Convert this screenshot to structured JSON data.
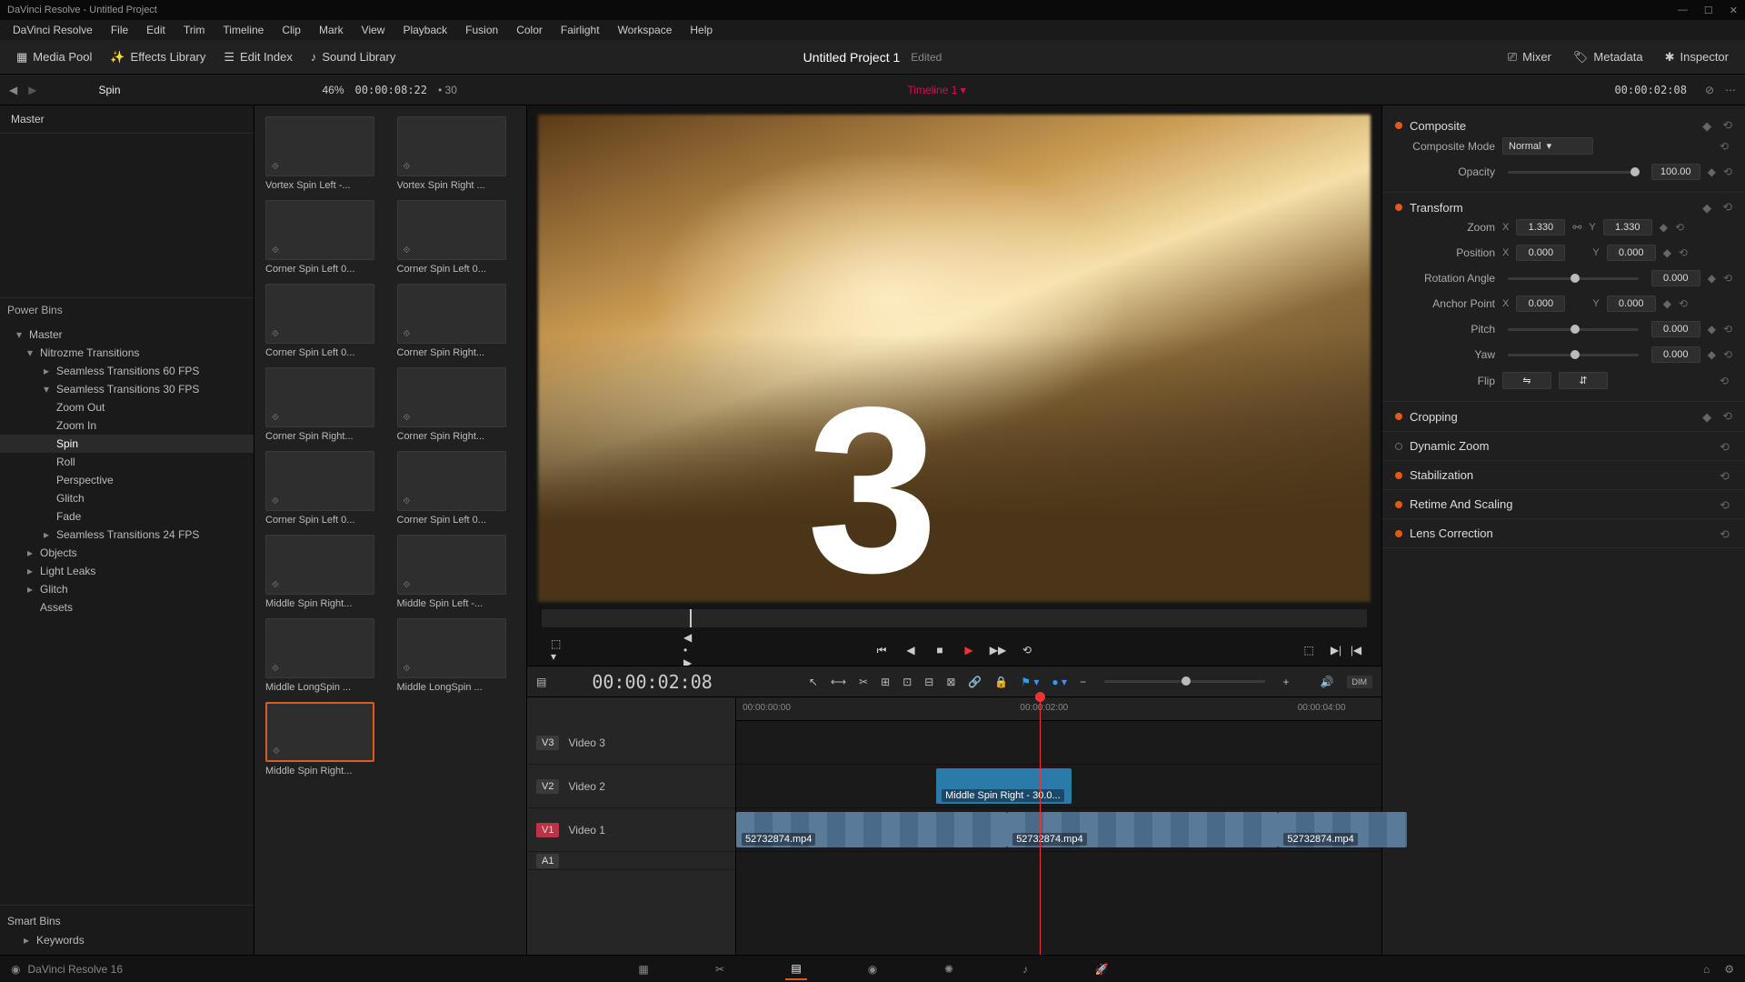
{
  "app": {
    "title": "DaVinci Resolve - Untitled Project",
    "name": "DaVinci Resolve 16"
  },
  "menu": [
    "DaVinci Resolve",
    "File",
    "Edit",
    "Trim",
    "Timeline",
    "Clip",
    "Mark",
    "View",
    "Playback",
    "Fusion",
    "Color",
    "Fairlight",
    "Workspace",
    "Help"
  ],
  "toolbar": {
    "media_pool": "Media Pool",
    "effects_library": "Effects Library",
    "edit_index": "Edit Index",
    "sound_library": "Sound Library",
    "project_title": "Untitled Project 1",
    "project_status": "Edited",
    "mixer": "Mixer",
    "metadata": "Metadata",
    "inspector": "Inspector"
  },
  "secbar": {
    "current_folder": "Spin",
    "zoom_pct": "46%",
    "timecode": "00:00:08:22",
    "fps": "• 30",
    "timeline_name": "Timeline 1",
    "timecode_right": "00:00:02:08"
  },
  "left_panel": {
    "master": "Master",
    "power_bins": "Power Bins",
    "smart_bins": "Smart Bins",
    "tree": [
      {
        "label": "Master",
        "level": 1,
        "arrow": "▾"
      },
      {
        "label": "Nitrozme Transitions",
        "level": 2,
        "arrow": "▾"
      },
      {
        "label": "Seamless Transitions 60 FPS",
        "level": 3,
        "arrow": "▸"
      },
      {
        "label": "Seamless Transitions 30 FPS",
        "level": 3,
        "arrow": "▾"
      },
      {
        "label": "Zoom Out",
        "level": 3
      },
      {
        "label": "Zoom In",
        "level": 3
      },
      {
        "label": "Spin",
        "level": 3,
        "active": true
      },
      {
        "label": "Roll",
        "level": 3
      },
      {
        "label": "Perspective",
        "level": 3
      },
      {
        "label": "Glitch",
        "level": 3
      },
      {
        "label": "Fade",
        "level": 3
      },
      {
        "label": "Seamless Transitions 24 FPS",
        "level": 3,
        "arrow": "▸"
      },
      {
        "label": "Objects",
        "level": 2,
        "arrow": "▸"
      },
      {
        "label": "Light Leaks",
        "level": 2,
        "arrow": "▸"
      },
      {
        "label": "Glitch",
        "level": 2,
        "arrow": "▸"
      },
      {
        "label": "Assets",
        "level": 2
      }
    ],
    "keywords": "Keywords"
  },
  "media_grid": [
    {
      "label": "Vortex Spin Left -..."
    },
    {
      "label": "Vortex Spin Right ..."
    },
    {
      "label": "Corner Spin Left 0..."
    },
    {
      "label": "Corner Spin Left 0..."
    },
    {
      "label": "Corner Spin Left 0..."
    },
    {
      "label": "Corner Spin Right..."
    },
    {
      "label": "Corner Spin Right..."
    },
    {
      "label": "Corner Spin Right..."
    },
    {
      "label": "Corner Spin Left 0..."
    },
    {
      "label": "Corner Spin Left 0..."
    },
    {
      "label": "Middle Spin Right..."
    },
    {
      "label": "Middle Spin Left -..."
    },
    {
      "label": "Middle LongSpin ..."
    },
    {
      "label": "Middle LongSpin ..."
    },
    {
      "label": "Middle Spin Right...",
      "selected": true
    }
  ],
  "countdown": "3",
  "timeline": {
    "timecode": "00:00:02:08",
    "ruler": [
      "00:00:00:00",
      "00:00:02:00",
      "00:00:04:00"
    ],
    "tracks": [
      {
        "id": "V3",
        "name": "Video 3"
      },
      {
        "id": "V2",
        "name": "Video 2"
      },
      {
        "id": "V1",
        "name": "Video 1"
      }
    ],
    "clips": {
      "v2_fx": "Middle Spin Right - 30.0...",
      "v1a": "52732874.mp4",
      "v1b": "52732874.mp4",
      "v1c": "52732874.mp4"
    },
    "audio_id": "A1"
  },
  "inspector": {
    "composite": {
      "title": "Composite",
      "mode_label": "Composite Mode",
      "mode_value": "Normal",
      "opacity_label": "Opacity",
      "opacity_value": "100.00"
    },
    "transform": {
      "title": "Transform",
      "zoom_label": "Zoom",
      "zoom_x": "1.330",
      "zoom_y": "1.330",
      "position_label": "Position",
      "pos_x": "0.000",
      "pos_y": "0.000",
      "rotation_label": "Rotation Angle",
      "rotation_value": "0.000",
      "anchor_label": "Anchor Point",
      "anchor_x": "0.000",
      "anchor_y": "0.000",
      "pitch_label": "Pitch",
      "pitch_value": "0.000",
      "yaw_label": "Yaw",
      "yaw_value": "0.000",
      "flip_label": "Flip"
    },
    "cropping_title": "Cropping",
    "dynamic_zoom_title": "Dynamic Zoom",
    "stabilization_title": "Stabilization",
    "retime_title": "Retime And Scaling",
    "lens_title": "Lens Correction",
    "axis_x": "X",
    "axis_y": "Y"
  }
}
